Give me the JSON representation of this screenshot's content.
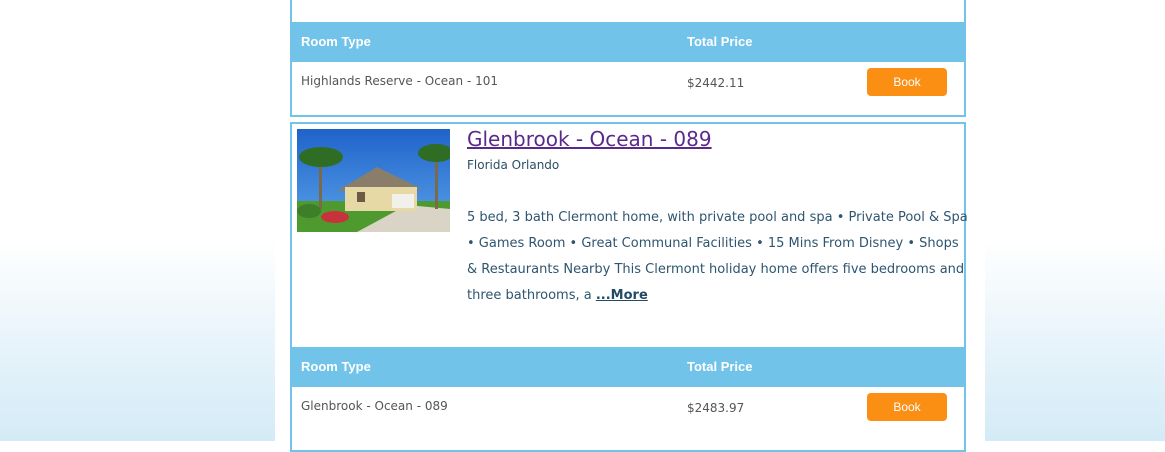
{
  "listing1": {
    "header": {
      "room_type": "Room Type",
      "total_price": "Total Price"
    },
    "room": {
      "name": "Highlands Reserve - Ocean - 101",
      "price": "$2442.11",
      "book_label": "Book"
    }
  },
  "listing2": {
    "title": "Glenbrook - Ocean - 089",
    "location": "Florida Orlando",
    "description": "5 bed, 3 bath Clermont home, with private pool and spa • Private Pool & Spa • Games Room • Great Communal Facilities • 15 Mins From Disney • Shops & Restaurants Nearby This Clermont holiday home offers five bedrooms and three bathrooms, a ",
    "more_label": "...More",
    "header": {
      "room_type": "Room Type",
      "total_price": "Total Price"
    },
    "room": {
      "name": "Glenbrook - Ocean - 089",
      "price": "$2483.97",
      "book_label": "Book"
    }
  },
  "colors": {
    "accent": "#72c3ea",
    "button": "#fb8f14",
    "title_link": "#5a2a8a"
  }
}
